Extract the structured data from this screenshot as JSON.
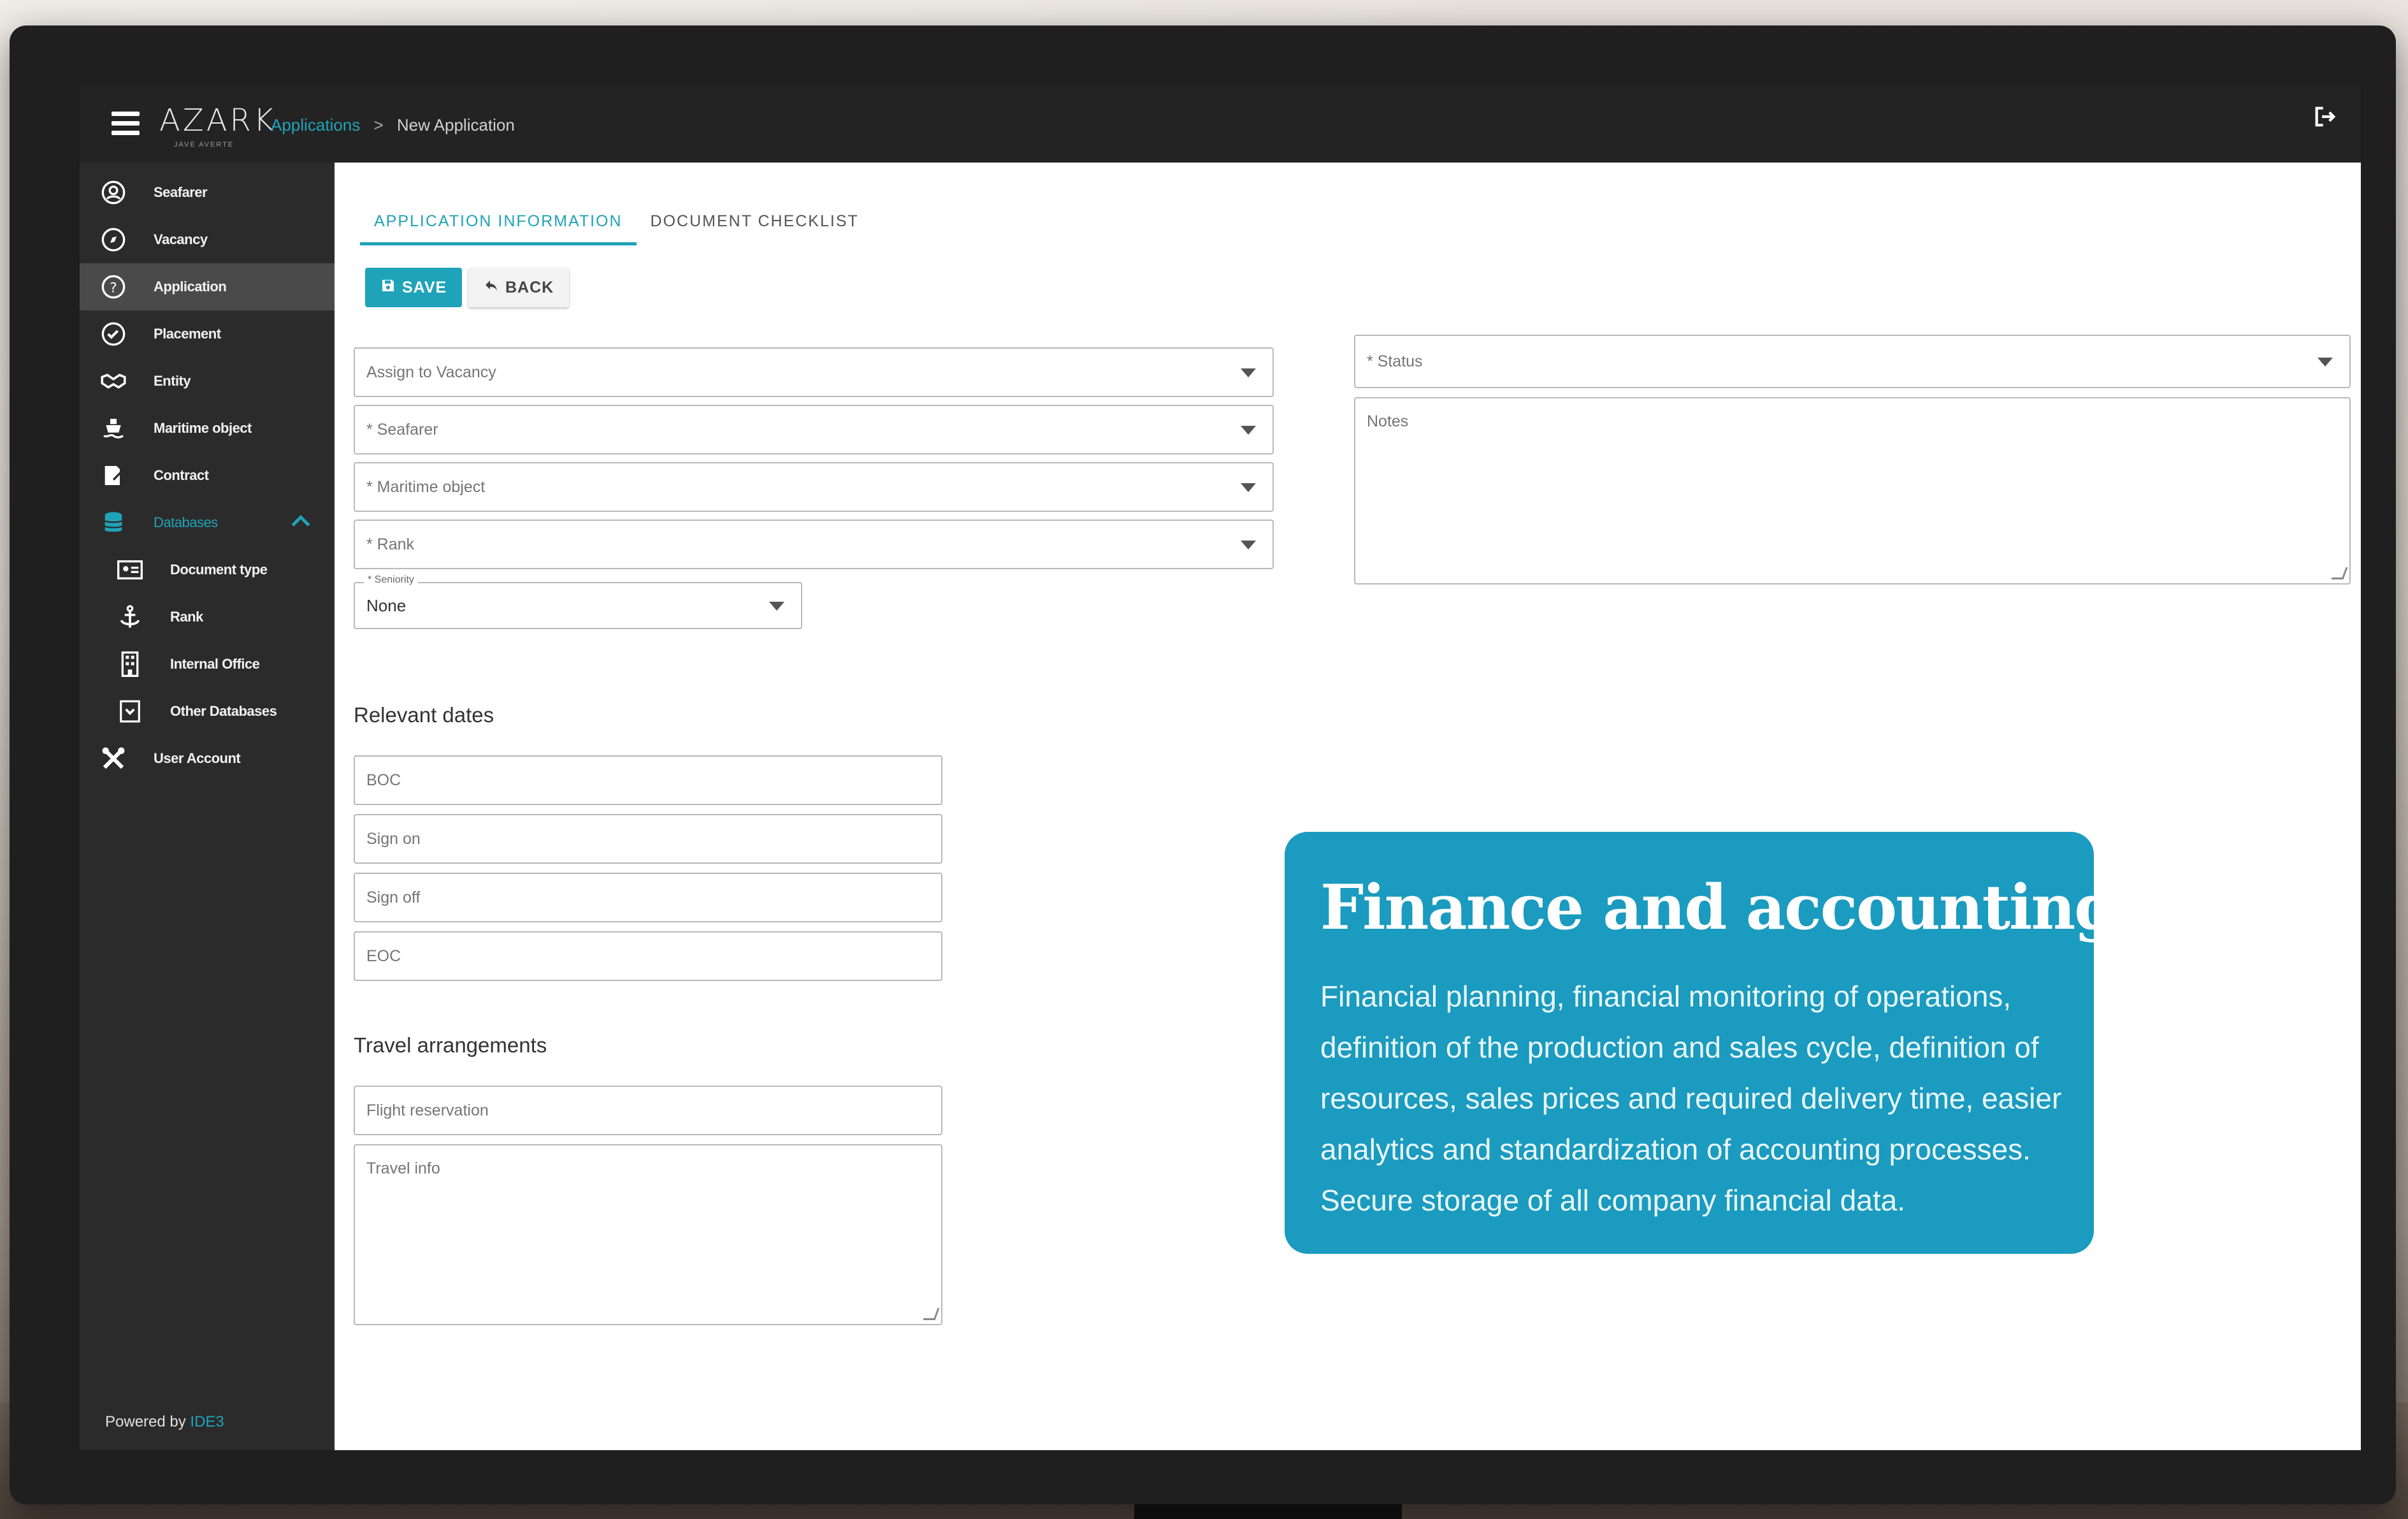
{
  "window": {
    "logo_text": "AZARK",
    "logo_sub": "JAVE AVERTE",
    "breadcrumb": {
      "link": "Applications",
      "separator": ">",
      "current": "New Application"
    }
  },
  "sidebar": {
    "items": [
      {
        "label": "Seafarer",
        "icon": "user-circle-icon"
      },
      {
        "label": "Vacancy",
        "icon": "compass-icon"
      },
      {
        "label": "Application",
        "icon": "question-circle-icon"
      },
      {
        "label": "Placement",
        "icon": "check-circle-icon"
      },
      {
        "label": "Entity",
        "icon": "handshake-icon"
      },
      {
        "label": "Maritime object",
        "icon": "ship-icon"
      },
      {
        "label": "Contract",
        "icon": "signature-icon"
      },
      {
        "label": "Databases",
        "icon": "database-icon"
      }
    ],
    "subitems": [
      {
        "label": "Document type",
        "icon": "id-card-icon"
      },
      {
        "label": "Rank",
        "icon": "anchor-icon"
      },
      {
        "label": "Internal Office",
        "icon": "building-icon"
      },
      {
        "label": "Other Databases",
        "icon": "archive-icon"
      }
    ],
    "footer_item": {
      "label": "User Account",
      "icon": "tools-icon"
    },
    "powered_by": "Powered by",
    "powered_brand": "IDE3"
  },
  "tabs": [
    {
      "label": "APPLICATION INFORMATION",
      "active": true
    },
    {
      "label": "DOCUMENT CHECKLIST",
      "active": false
    }
  ],
  "toolbar": {
    "save_label": "SAVE",
    "back_label": "BACK"
  },
  "form": {
    "assign_vacancy": "Assign to Vacancy",
    "seafarer": "* Seafarer",
    "maritime_object": "* Maritime object",
    "rank": "* Rank",
    "seniority_label": "* Seniority",
    "seniority_value": "None",
    "status": "* Status",
    "notes": "Notes"
  },
  "dates": {
    "title": "Relevant dates",
    "boc": "BOC",
    "sign_on": "Sign on",
    "sign_off": "Sign off",
    "eoc": "EOC"
  },
  "travel": {
    "title": "Travel arrangements",
    "flight": "Flight reservation",
    "info": "Travel info"
  },
  "card": {
    "title": "Finance and accounting",
    "body": "Financial planning, financial monitoring of operations, definition of the production and sales cycle, definition of resources, sales prices and required delivery time, easier analytics and standardization of accounting processes. Secure storage of all company financial data."
  },
  "colors": {
    "accent": "#1fa3b8",
    "card": "#1a9bbf",
    "sidebar": "#2b2b2b",
    "topbar": "#232323"
  }
}
